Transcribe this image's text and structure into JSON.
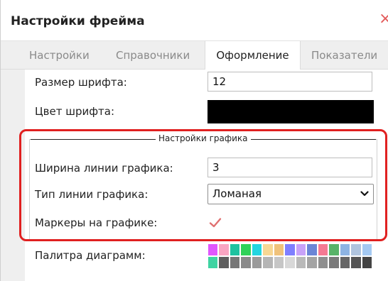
{
  "window": {
    "title": "Настройки фрейма",
    "close_symbol": "×"
  },
  "tabs": [
    {
      "label": "Настройки",
      "active": false
    },
    {
      "label": "Справочники",
      "active": false
    },
    {
      "label": "Оформление",
      "active": true
    },
    {
      "label": "Показатели",
      "active": false
    }
  ],
  "fields": {
    "font_size": {
      "label": "Размер шрифта:",
      "value": "12"
    },
    "font_color": {
      "label": "Цвет шрифта:",
      "value": "#000000"
    },
    "chart_group": {
      "legend": "Настройки графика"
    },
    "line_width": {
      "label": "Ширина линии графика:",
      "value": "3"
    },
    "line_type": {
      "label": "Тип линии графика:",
      "value": "Ломаная"
    },
    "markers": {
      "label": "Маркеры на графике:",
      "checked": true
    },
    "palette": {
      "label": "Палитра диаграмм:",
      "colors_top": [
        "#e056fd",
        "#f9a5c2",
        "#1fc2a0",
        "#30d158",
        "#23d5e0",
        "#f7d794",
        "#f0c27b",
        "#7f7fff",
        "#c8a2f8",
        "#6b85d6",
        "#f57a93",
        "#58b368",
        "#8eb4e3",
        "#b0c4de",
        "#a4c9f2"
      ],
      "colors_bottom": [
        "#3fd3a2",
        "#5e5e5e",
        "#777777",
        "#8a8a8a",
        "#9b9b9b",
        "#b5b5b5",
        "#c6c6c6",
        "#d8d8d8",
        "#b9b9b9",
        "#a4a4a4",
        "#8f8f8f",
        "#7a7a7a",
        "#666666",
        "#555555",
        "#444444"
      ]
    }
  },
  "colors": {
    "highlight": "#e02020",
    "close": "#e35b5b",
    "check": "#e07070"
  }
}
